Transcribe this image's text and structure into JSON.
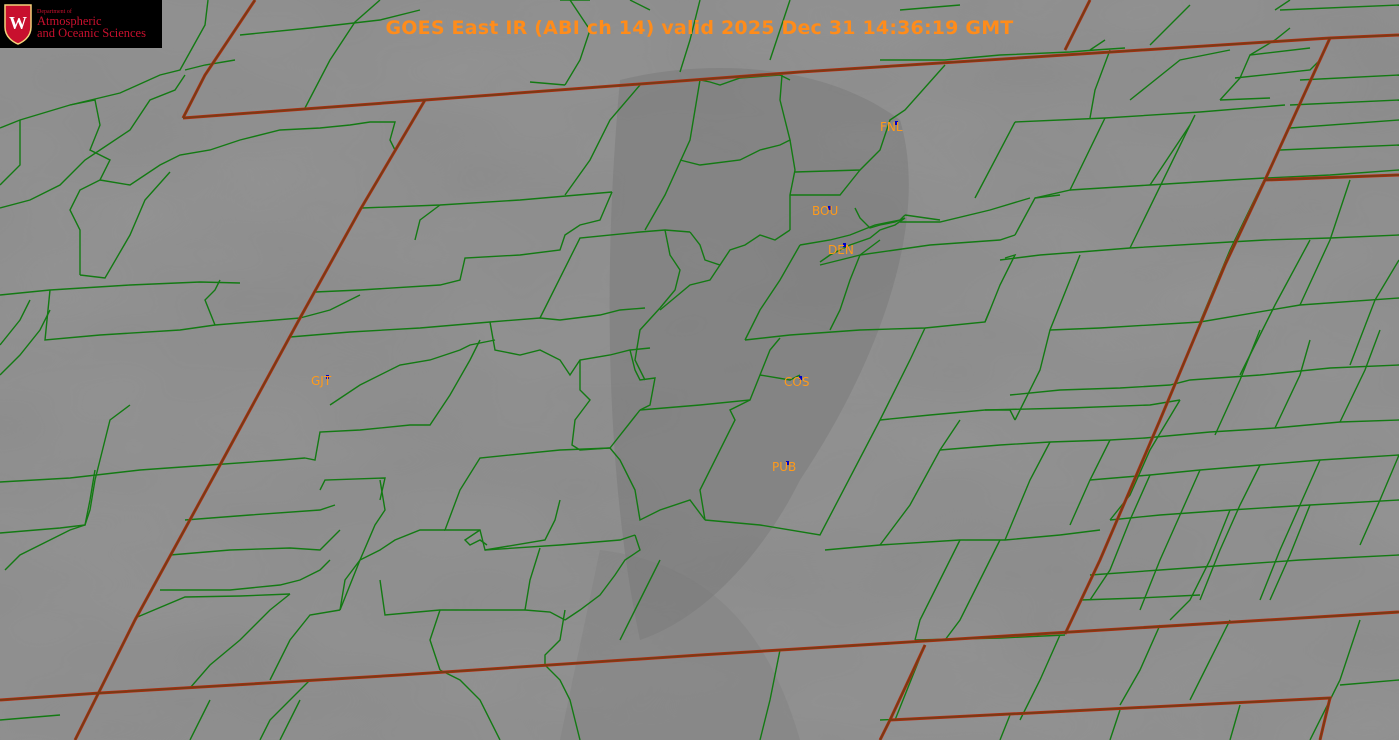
{
  "title": "GOES East IR (ABI ch 14) valid 2025 Dec 31 14:36:19 GMT",
  "logo": {
    "crest_letter": "W",
    "dept_line": "Department of",
    "line1": "Atmospheric",
    "line2": "and Oceanic Sciences"
  },
  "stations": [
    {
      "id": "FNL"
    },
    {
      "id": "BOU"
    },
    {
      "id": "DEN"
    },
    {
      "id": "GJT"
    },
    {
      "id": "COS"
    },
    {
      "id": "PUB"
    }
  ],
  "colors": {
    "county_lines": "#1a7a1a",
    "state_lines": "#7a3a14",
    "station_labels": "#ff9a1a",
    "title": "#ff8c1a",
    "background_ir": "#888888"
  }
}
